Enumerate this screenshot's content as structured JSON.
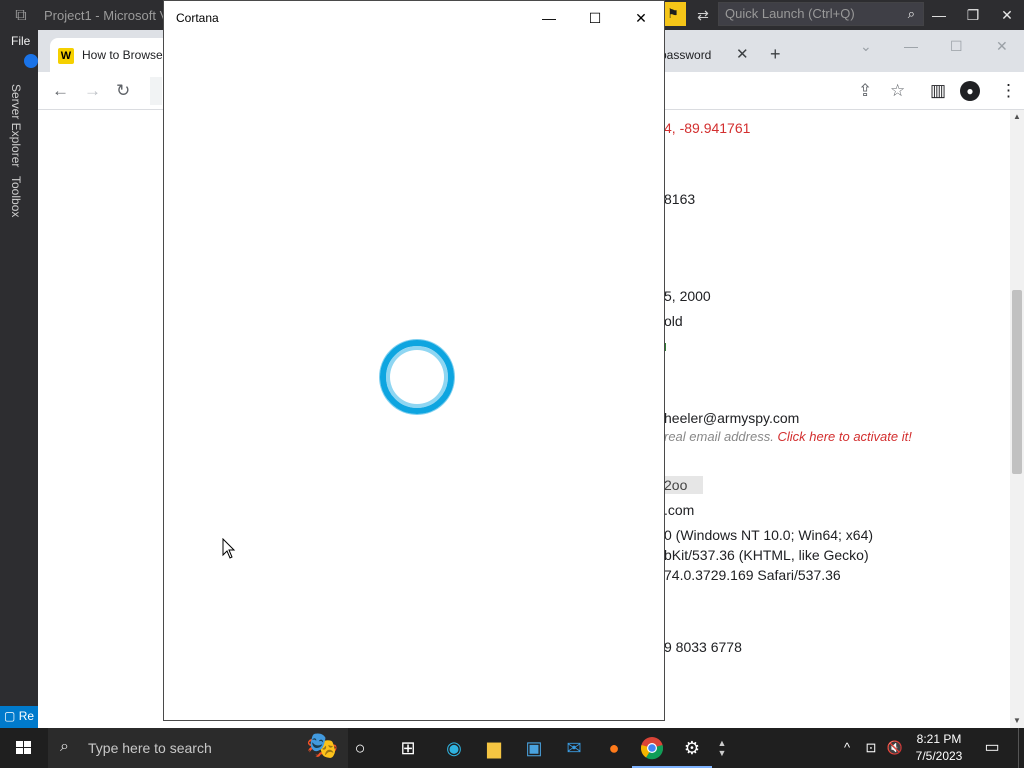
{
  "vs": {
    "logo": "⧉",
    "title": "Project1 - Microsoft Vi",
    "file_menu": "File",
    "side_tabs": [
      "Server Explorer",
      "Toolbox"
    ],
    "quick_launch_placeholder": "Quick Launch (Ctrl+Q)",
    "status_text": "Re"
  },
  "chrome": {
    "tab_active_label": "How to Browse",
    "tab_active_favicon": "W",
    "tab2_label": "password",
    "tab2_close": "✕",
    "newtab": "+",
    "page_lines": [
      {
        "text": "4, -89.941761",
        "color": "#d32f2f"
      },
      {
        "text": "8163",
        "color": "#202124"
      },
      {
        "text": "5, 2000",
        "color": "#202124"
      },
      {
        "text": "old",
        "color": "#202124"
      },
      {
        "text": "heeler@armyspy.com",
        "color": "#202124"
      },
      {
        "text": "2oo",
        "color": "#202124"
      },
      {
        "text": ".com",
        "color": "#202124"
      },
      {
        "text": "0 (Windows NT 10.0; Win64; x64)",
        "color": "#202124"
      },
      {
        "text": "bKit/537.36 (KHTML, like Gecko)",
        "color": "#202124"
      },
      {
        "text": "74.0.3729.169 Safari/537.36",
        "color": "#202124"
      },
      {
        "text": "9 8033 6778",
        "color": "#202124"
      }
    ],
    "email_note_gray": "real email address.",
    "email_note_red": "Click here to activate it!"
  },
  "cortana": {
    "title": "Cortana",
    "minimize": "—",
    "maximize": "☐",
    "close": "✕"
  },
  "taskbar": {
    "search_placeholder": "Type here to search",
    "time": "8:21 PM",
    "date": "7/5/2023"
  }
}
